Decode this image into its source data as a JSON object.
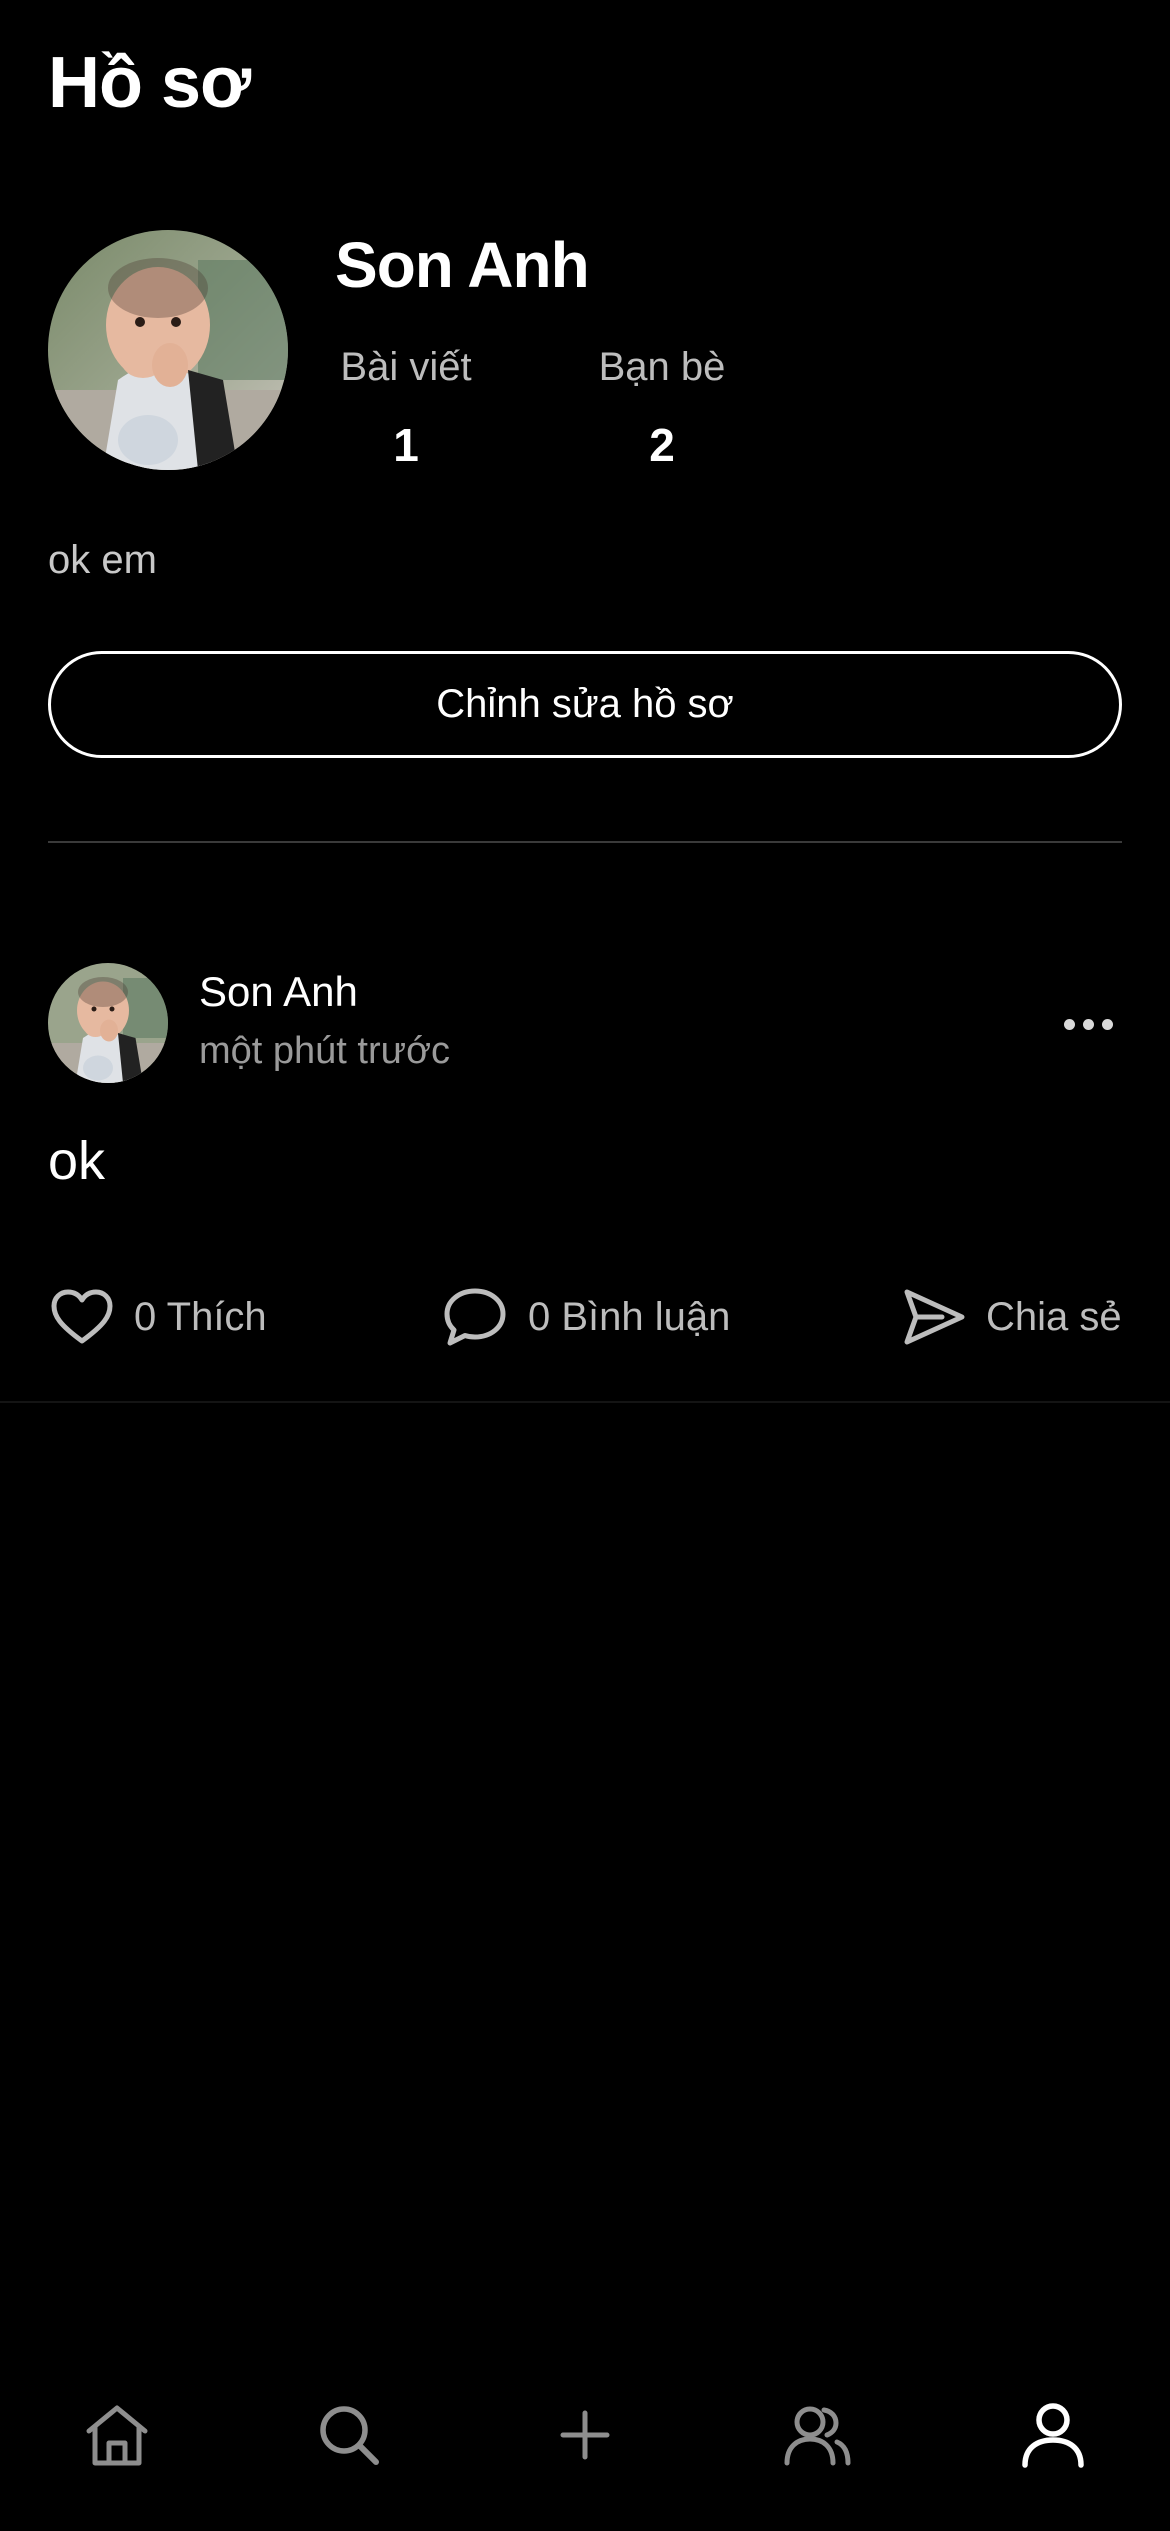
{
  "header": {
    "title": "Hồ sơ"
  },
  "profile": {
    "name": "Son Anh",
    "stats": {
      "posts_label": "Bài viết",
      "posts_value": "1",
      "friends_label": "Bạn bè",
      "friends_value": "2"
    },
    "bio": "ok em",
    "edit_button_label": "Chỉnh sửa hồ sơ"
  },
  "post": {
    "author": "Son Anh",
    "time": "một phút trước",
    "content": "ok",
    "like_label": "0 Thích",
    "comment_label": "0 Bình luận",
    "share_label": "Chia sẻ"
  },
  "bottom_nav": {
    "items": [
      {
        "icon": "home-icon",
        "active": false
      },
      {
        "icon": "search-icon",
        "active": false
      },
      {
        "icon": "plus-icon",
        "active": false
      },
      {
        "icon": "friends-icon",
        "active": false
      },
      {
        "icon": "profile-icon",
        "active": true
      }
    ]
  },
  "colors": {
    "background": "#000000",
    "text_primary": "#ffffff",
    "text_secondary": "#bdbdbd",
    "nav_inactive": "#8e8e8e",
    "nav_active": "#ffffff"
  }
}
